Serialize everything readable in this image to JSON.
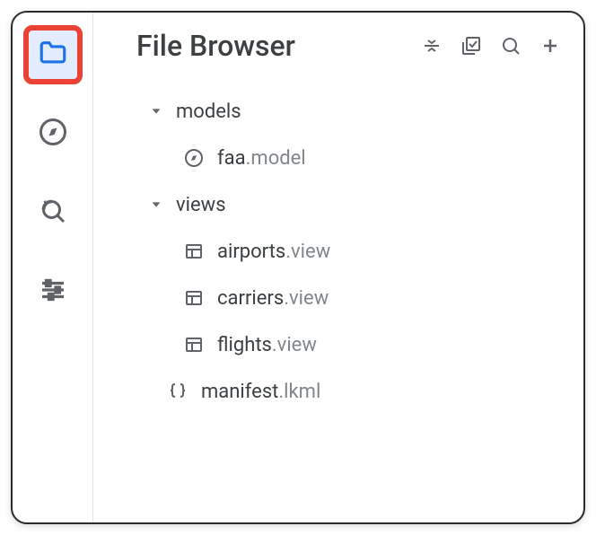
{
  "header": {
    "title": "File Browser"
  },
  "tree": {
    "folders": [
      {
        "label": "models"
      },
      {
        "label": "views"
      }
    ],
    "models_files": [
      {
        "name": "faa",
        "ext": ".model"
      }
    ],
    "views_files": [
      {
        "name": "airports",
        "ext": ".view"
      },
      {
        "name": "carriers",
        "ext": ".view"
      },
      {
        "name": "flights",
        "ext": ".view"
      }
    ],
    "root_files": [
      {
        "name": "manifest",
        "ext": ".lkml"
      }
    ]
  }
}
